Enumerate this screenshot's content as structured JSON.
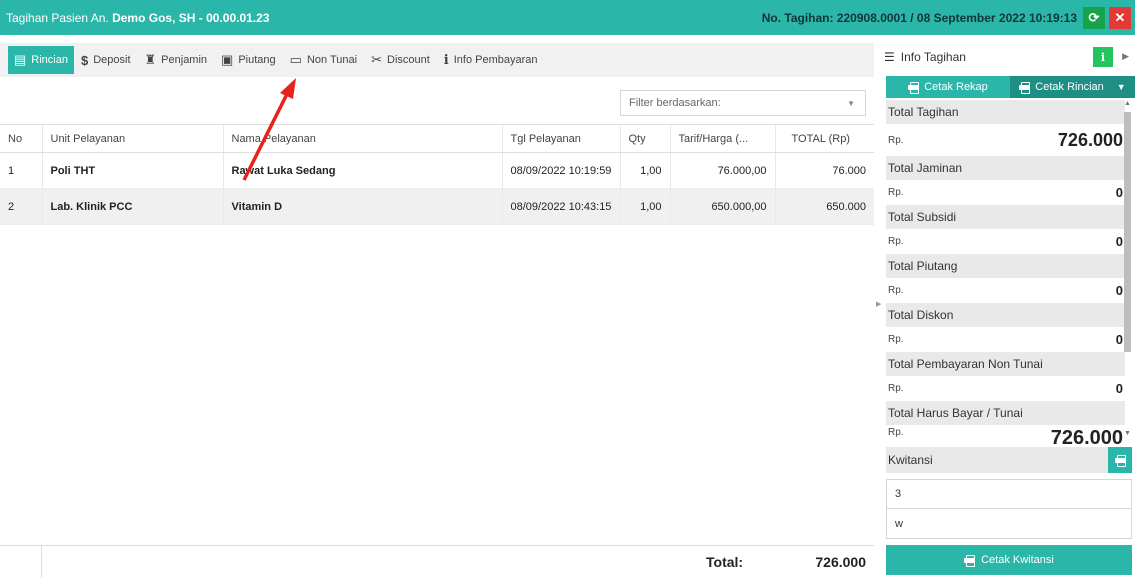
{
  "titlebar": {
    "patient_prefix": "Tagihan Pasien An. ",
    "patient_name": "Demo Gos, SH - 00.00.01.23",
    "invoice": "No. Tagihan: 220908.0001 / 08 September 2022 10:19:13",
    "refresh_icon": "refresh-icon",
    "close_icon": "close-icon"
  },
  "tabs": [
    {
      "label": "Rincian",
      "icon": "table-icon",
      "glyph": "▤"
    },
    {
      "label": "Deposit",
      "icon": "dollar-icon",
      "glyph": "$"
    },
    {
      "label": "Penjamin",
      "icon": "user-tie-icon",
      "glyph": "♜"
    },
    {
      "label": "Piutang",
      "icon": "money-icon",
      "glyph": "▣"
    },
    {
      "label": "Non Tunai",
      "icon": "credit-card-icon",
      "glyph": "▭"
    },
    {
      "label": "Discount",
      "icon": "discount-icon",
      "glyph": "✂"
    },
    {
      "label": "Info Pembayaran",
      "icon": "info-icon",
      "glyph": "i"
    }
  ],
  "filter": {
    "placeholder": "Filter berdasarkan:"
  },
  "table": {
    "headers": [
      "No",
      "Unit Pelayanan",
      "Nama Pelayanan",
      "Tgl Pelayanan",
      "Qty",
      "Tarif/Harga (...",
      "TOTAL (Rp)"
    ],
    "rows": [
      {
        "no": "1",
        "unit": "Poli THT",
        "nama": "Rawat Luka Sedang",
        "tgl": "08/09/2022 10:19:59",
        "qty": "1,00",
        "tarif": "76.000,00",
        "total": "76.000"
      },
      {
        "no": "2",
        "unit": "Lab. Klinik PCC",
        "nama": "Vitamin D",
        "tgl": "08/09/2022 10:43:15",
        "qty": "1,00",
        "tarif": "650.000,00",
        "total": "650.000"
      }
    ]
  },
  "footer": {
    "label": "Total:",
    "value": "726.000"
  },
  "info_panel": {
    "title": "Info Tagihan",
    "btn_rekap": "Cetak Rekap",
    "btn_rincian": "Cetak Rincian",
    "currency": "Rp.",
    "items": [
      {
        "label": "Total Tagihan",
        "value": "726.000"
      },
      {
        "label": "Total Jaminan",
        "value": "0"
      },
      {
        "label": "Total Subsidi",
        "value": "0"
      },
      {
        "label": "Total Piutang",
        "value": "0"
      },
      {
        "label": "Total Diskon",
        "value": "0"
      },
      {
        "label": "Total Pembayaran Non Tunai",
        "value": "0"
      },
      {
        "label": "Total Harus Bayar / Tunai",
        "value": "726.000"
      }
    ]
  },
  "kwitansi": {
    "label": "Kwitansi",
    "input1": "3",
    "input2": "w",
    "button": "Cetak Kwitansi"
  },
  "colors": {
    "accent": "#2ab7a9",
    "danger": "#e53935",
    "success": "#16a34a",
    "arrow": "#e8211c"
  }
}
